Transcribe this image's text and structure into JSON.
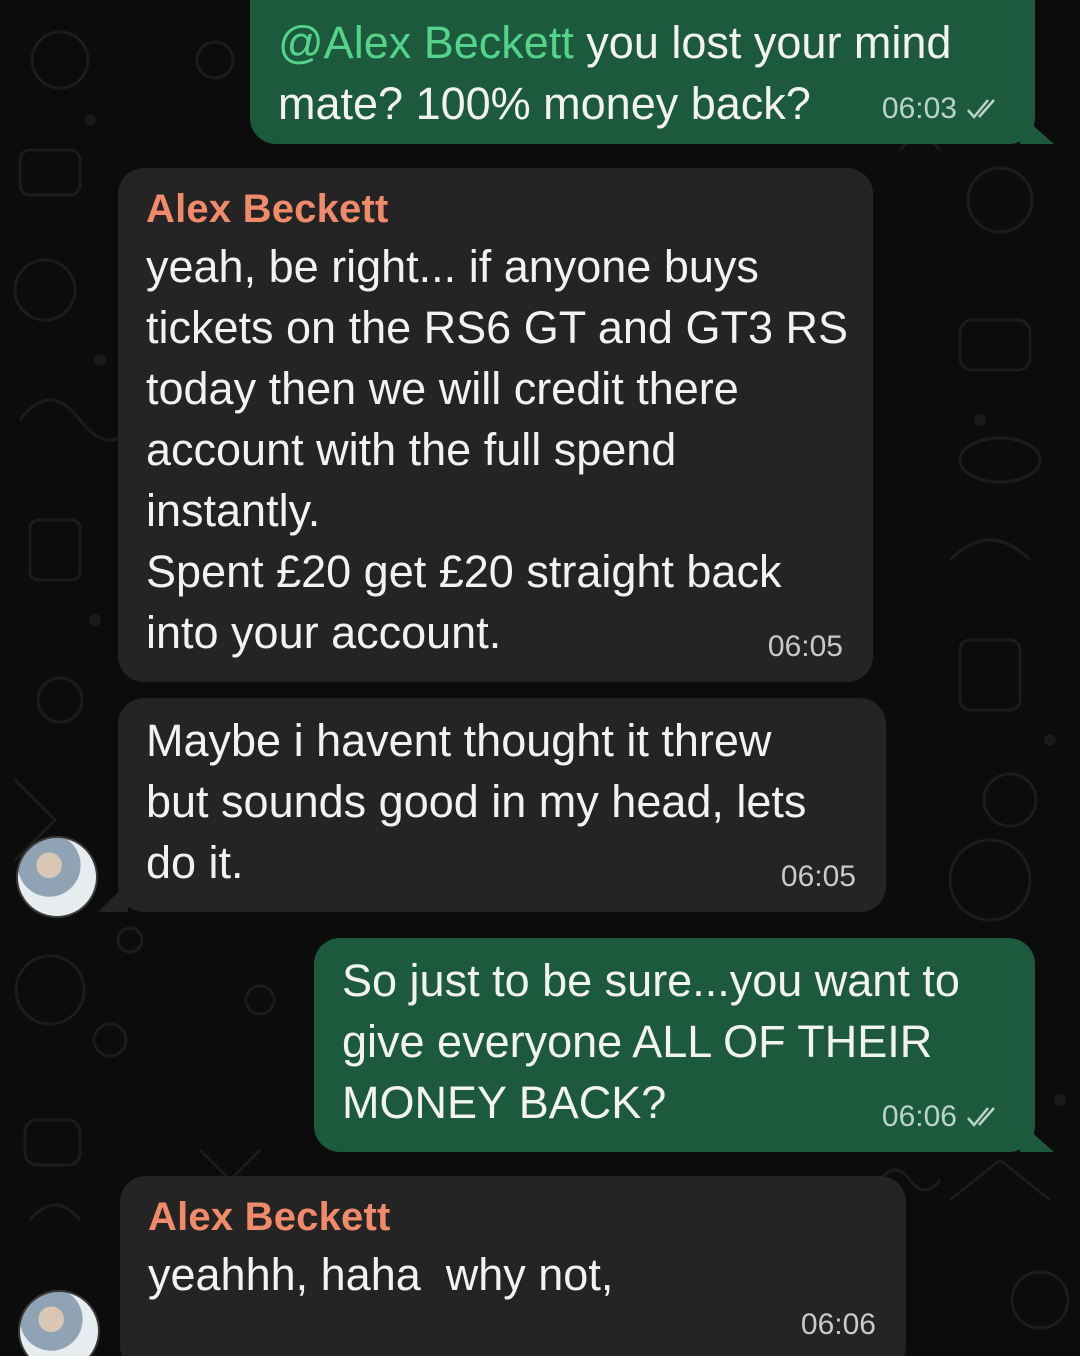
{
  "messages": [
    {
      "direction": "outgoing",
      "mention": "@Alex Beckett",
      "lines": [
        " you lost your mind",
        "mate? 100% money back?"
      ],
      "time": "06:03",
      "status": "read-double-check-icon"
    },
    {
      "direction": "incoming",
      "sender": "Alex Beckett",
      "lines": [
        "yeah, be right... if anyone buys",
        "tickets on the RS6 GT and GT3 RS",
        "today then we will credit there",
        "account with the full spend",
        "instantly.",
        "Spent £20 get £20 straight back",
        "into your account."
      ],
      "time": "06:05"
    },
    {
      "direction": "incoming",
      "lines": [
        "Maybe i havent thought it threw",
        "but sounds good in my head, lets",
        "do it."
      ],
      "time": "06:05"
    },
    {
      "direction": "outgoing",
      "lines": [
        "So just to be sure...you want to",
        "give everyone ALL OF THEIR",
        "MONEY BACK?"
      ],
      "time": "06:06",
      "status": "read-double-check-icon"
    },
    {
      "direction": "incoming",
      "sender": "Alex Beckett",
      "lines": [
        "yeahhh, haha  why not,"
      ],
      "time": "06:06"
    }
  ],
  "colors": {
    "outgoing_bubble": "#1d5a3d",
    "incoming_bubble": "#242424",
    "sender_name": "#f08a6a",
    "mention": "#53d48a",
    "background": "#0c0c0c"
  }
}
